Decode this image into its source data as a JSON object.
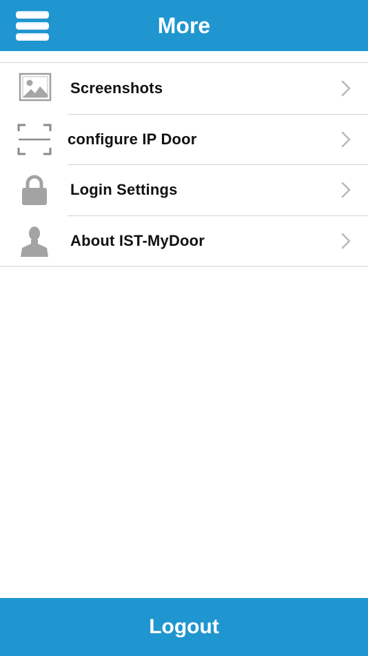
{
  "header": {
    "title": "More",
    "menu_icon": "hamburger-menu-icon",
    "background_color": "#1f96cf"
  },
  "menu": {
    "items": [
      {
        "label": "Screenshots",
        "icon": "image-icon"
      },
      {
        "label": "configure IP Door",
        "icon": "scan-frame-icon"
      },
      {
        "label": "Login Settings",
        "icon": "lock-icon"
      },
      {
        "label": "About IST-MyDoor",
        "icon": "person-icon"
      }
    ],
    "chevron_icon": "chevron-right-icon",
    "icon_color": "#9e9e9e"
  },
  "footer": {
    "logout_label": "Logout",
    "background_color": "#1f96cf"
  }
}
